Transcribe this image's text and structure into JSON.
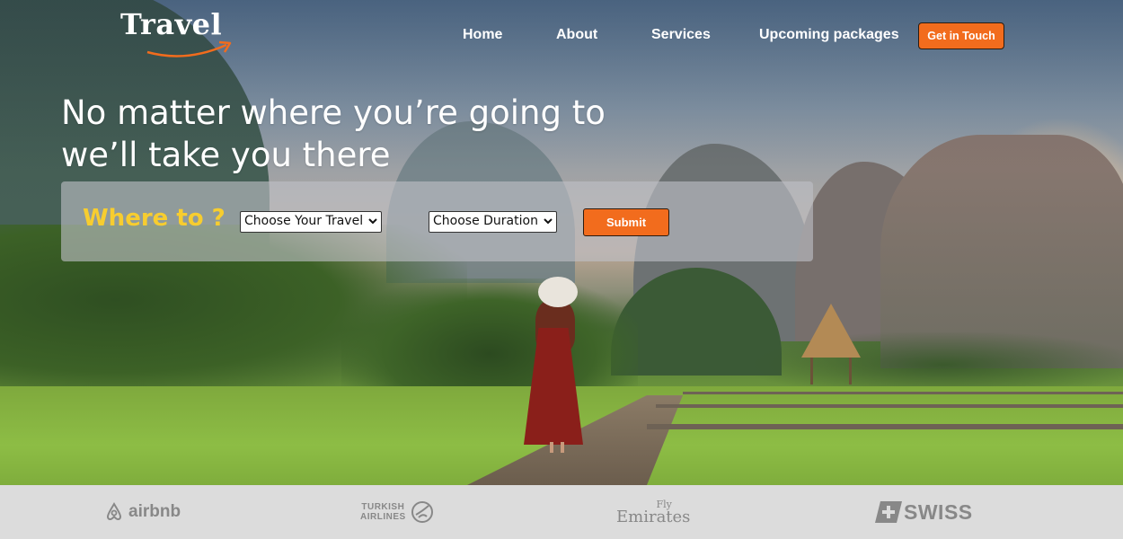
{
  "brand": {
    "logo_text": "Travel",
    "accent_color": "#f26c1d"
  },
  "nav": {
    "items": [
      {
        "label": "Home"
      },
      {
        "label": "About"
      },
      {
        "label": "Services"
      },
      {
        "label": "Upcoming packages"
      }
    ],
    "cta_label": "Get in Touch"
  },
  "hero": {
    "headline_line1": "No matter where you’re going to",
    "headline_line2": "we’ll take you there"
  },
  "search": {
    "title": "Where to ?",
    "travel_select": {
      "selected": "Choose Your Travel"
    },
    "duration_select": {
      "selected": "Choose Duration"
    },
    "submit_label": "Submit",
    "title_color": "#f7cd2f"
  },
  "partners": {
    "airbnb": "airbnb",
    "turkish_line1": "TURKISH",
    "turkish_line2": "AIRLINES",
    "emirates_fly": "Fly",
    "emirates_name": "Emirates",
    "swiss": "SWISS"
  }
}
